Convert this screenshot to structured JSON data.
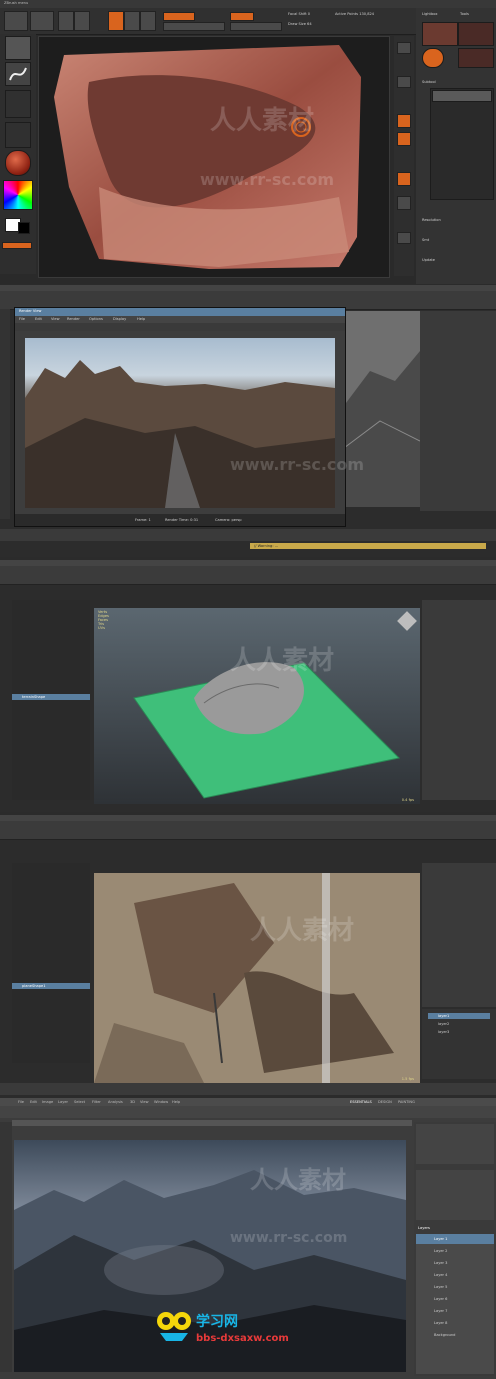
{
  "zbrush": {
    "menu": "ZBrush menu",
    "brush_stats": [
      "Focal Shift 0",
      "Draw Size 64",
      "Active Points 130,824"
    ],
    "right_tabs": [
      "Lightbox",
      "Tools"
    ],
    "subtool": "Subtool",
    "fields": [
      "Resolution",
      "Smt",
      "Update"
    ]
  },
  "maya1": {
    "render_window_title": "Render View",
    "render_menu": [
      "File",
      "Edit",
      "View",
      "Render",
      "Options",
      "Display",
      "Help"
    ],
    "render_status": [
      "Frame: 1",
      "Render Time: 0:31",
      "Camera: persp"
    ],
    "warning": "// Warning: ..."
  },
  "maya2": {
    "stats_rows": [
      "Verts",
      "Edges",
      "Faces",
      "Tris",
      "UVs"
    ],
    "fps": "0.4 fps",
    "outliner_sel": "terrainShape"
  },
  "maya3": {
    "fps": "1.5 fps",
    "outliner_sel": "planeShape1",
    "layers": [
      "layer1",
      "layer2",
      "layer3"
    ]
  },
  "photoshop": {
    "menu": [
      "File",
      "Edit",
      "Image",
      "Layer",
      "Select",
      "Filter",
      "Analysis",
      "3D",
      "View",
      "Window",
      "Help"
    ],
    "workspace": [
      "ESSENTIALS",
      "DESIGN",
      "PAINTING"
    ],
    "layers_title": "Layers",
    "layers": [
      "Layer 1",
      "Layer 2",
      "Layer 3",
      "Layer 4",
      "Layer 5",
      "Layer 6",
      "Layer 7",
      "Layer 8",
      "Background"
    ]
  },
  "watermarks": {
    "top": "人人素材",
    "url": "www.rr-sc.com",
    "logo_text": "学习网",
    "logo_url": "bbs-dxsaxw.com"
  },
  "colors": {
    "zbrush_orange": "#d9641e",
    "maya_grid": "#3e3e3e",
    "terrain_green": "#3fbf7a",
    "logo_yellow": "#f5d60a",
    "logo_cyan": "#18b5e6",
    "logo_red": "#e83a3a"
  }
}
